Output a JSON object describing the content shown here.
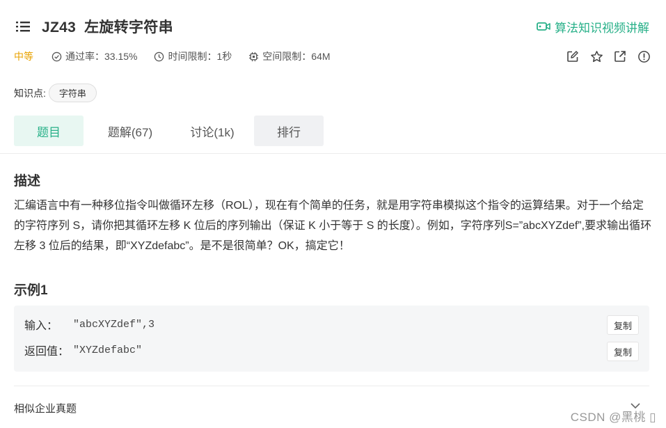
{
  "header": {
    "code": "JZ43",
    "title": "左旋转字符串",
    "video_link": "算法知识视频讲解"
  },
  "meta": {
    "difficulty": "中等",
    "pass_rate": "通过率：33.15%",
    "time_limit": "时间限制：1秒",
    "space_limit": "空间限制：64M"
  },
  "knowledge": {
    "label": "知识点:",
    "tags": [
      "字符串"
    ]
  },
  "tabs": [
    {
      "label": "题目"
    },
    {
      "label": "题解(67)"
    },
    {
      "label": "讨论(1k)"
    },
    {
      "label": "排行"
    }
  ],
  "description": {
    "heading": "描述",
    "text": "汇编语言中有一种移位指令叫做循环左移（ROL），现在有个简单的任务，就是用字符串模拟这个指令的运算结果。对于一个给定的字符序列 S，请你把其循环左移 K 位后的序列输出（保证 K 小于等于 S 的长度）。例如，字符序列S=”abcXYZdef”,要求输出循环左移 3 位后的结果，即“XYZdefabc”。是不是很简单？OK，搞定它！"
  },
  "example": {
    "heading": "示例1",
    "input_label": "输入：",
    "input_value": "\"abcXYZdef\",3",
    "output_label": "返回值：",
    "output_value": "\"XYZdefabc\"",
    "copy_label": "复制"
  },
  "similar": {
    "heading": "相似企业真题"
  },
  "watermark": "CSDN @黑桃 ▯",
  "colors": {
    "accent": "#27b088",
    "difficulty": "#e8a200",
    "active_tab_bg": "#e8f7f2"
  },
  "icons": {
    "list": "list-icon",
    "video": "video-icon",
    "pass_rate": "check-circle-icon",
    "time_limit": "clock-icon",
    "space_limit": "chip-icon",
    "tools": [
      "edit-icon",
      "star-icon",
      "share-icon",
      "report-icon"
    ]
  }
}
